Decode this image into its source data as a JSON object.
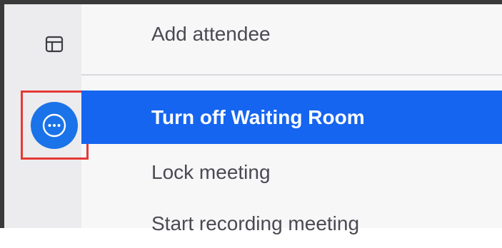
{
  "menu": {
    "items": [
      {
        "label": "Add attendee"
      },
      {
        "label": "Turn off Waiting Room",
        "highlighted": true
      },
      {
        "label": "Lock meeting"
      },
      {
        "label": "Start recording meeting"
      }
    ]
  },
  "rail": {
    "icons": [
      "layout-icon",
      "more-options-icon"
    ]
  },
  "colors": {
    "accent": "#1565f0",
    "more_button": "#1a73e8",
    "annotation_box": "#e53935"
  }
}
